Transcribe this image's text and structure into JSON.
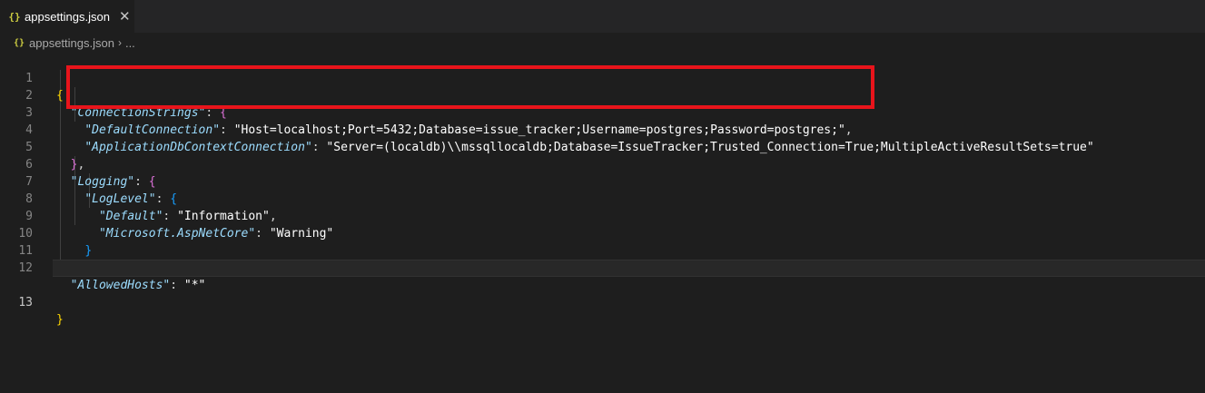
{
  "tab": {
    "title": "appsettings.json",
    "icon": "json-file-icon",
    "close": "✕"
  },
  "breadcrumb": {
    "file": "appsettings.json",
    "separator": "›",
    "more": "..."
  },
  "lines": [
    {
      "num": "1"
    },
    {
      "num": "2",
      "key": "\"ConnectionStrings\""
    },
    {
      "num": "3",
      "key": "\"DefaultConnection\"",
      "value": "\"Host=localhost;Port=5432;Database=issue_tracker;Username=postgres;Password=postgres;\""
    },
    {
      "num": "4",
      "key": "\"ApplicationDbContextConnection\"",
      "value": "\"Server=(localdb)\\\\mssqllocaldb;Database=IssueTracker;Trusted_Connection=True;MultipleActiveResultSets=true\""
    },
    {
      "num": "5"
    },
    {
      "num": "6",
      "key": "\"Logging\""
    },
    {
      "num": "7",
      "key": "\"LogLevel\""
    },
    {
      "num": "8",
      "key": "\"Default\"",
      "value": "\"Information\""
    },
    {
      "num": "9",
      "key": "\"Microsoft.AspNetCore\"",
      "value": "\"Warning\""
    },
    {
      "num": "10"
    },
    {
      "num": "11"
    },
    {
      "num": "12",
      "key": "\"AllowedHosts\"",
      "value": "\"*\""
    },
    {
      "num": "13"
    }
  ],
  "colors": {
    "background": "#1e1e1e",
    "key": "#9cdcfe",
    "annotation_box": "#e8141b",
    "bracket_level1": "#ffd700",
    "bracket_level2": "#da70d6",
    "bracket_level3": "#179fff"
  }
}
